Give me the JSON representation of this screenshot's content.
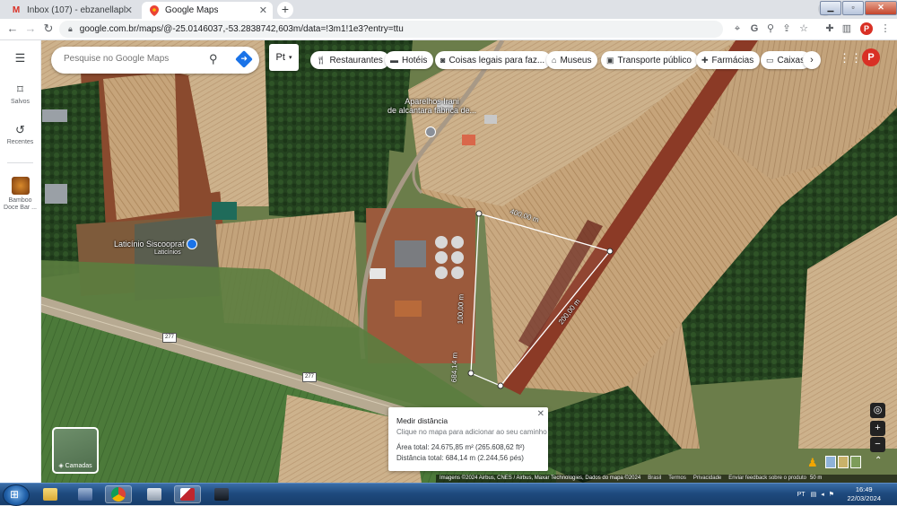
{
  "browser": {
    "tabs": [
      {
        "title": "Inbox (107) - ebzanellaplasticos@",
        "favicon": "gmail-icon",
        "active": false
      },
      {
        "title": "Google Maps",
        "favicon": "maps-pin-icon",
        "active": true
      }
    ],
    "url": "google.com.br/maps/@-25.0146037,-53.2838742,603m/data=!3m1!1e3?entry=ttu",
    "profile_initial": "P"
  },
  "maps": {
    "search_placeholder": "Pesquise no Google Maps",
    "language_btn": "Pt",
    "chips": [
      {
        "label": "Restaurantes",
        "icon": "fork-knife-icon"
      },
      {
        "label": "Hotéis",
        "icon": "bed-icon"
      },
      {
        "label": "Coisas legais para faz...",
        "icon": "camera-icon"
      },
      {
        "label": "Museus",
        "icon": "museum-icon"
      },
      {
        "label": "Transporte público",
        "icon": "bus-icon"
      },
      {
        "label": "Farmácias",
        "icon": "pharmacy-icon"
      },
      {
        "label": "Caixas",
        "icon": "atm-icon"
      }
    ],
    "rail": {
      "saved": "Salvos",
      "recent": "Recentes",
      "recent_place": "Bamboo Doce Bar ..."
    },
    "profile_initial": "P",
    "places": [
      {
        "line1": "Aparelhos Irani",
        "line2": "de alcantara fabrica de..."
      },
      {
        "line1": "Laticínio Siscoopraf",
        "line2": "Laticínios"
      }
    ],
    "route_label": "277",
    "measure_labels": {
      "seg1": "400,00 m",
      "seg2": "200,00 m",
      "seg3": "100,00 m",
      "total": "684,14 m"
    },
    "measure_panel": {
      "title": "Medir distância",
      "hint": "Clique no mapa para adicionar ao seu caminho",
      "area": "Área total: 24.675,85 m² (265.608,62 ft²)",
      "distance": "Distância total: 684,14 m (2.244,56 pés)"
    },
    "layers_label": "Camadas",
    "attribution": {
      "imagery": "Imagens ©2024 Airbus, CNES / Airbus, Maxar Technologies, Dados do mapa ©2024",
      "country": "Brasil",
      "terms": "Termos",
      "privacy": "Privacidade",
      "feedback": "Enviar feedback sobre o produto",
      "scale": "50 m"
    }
  },
  "taskbar": {
    "language": "PT",
    "time": "16:49",
    "date": "22/03/2024"
  }
}
